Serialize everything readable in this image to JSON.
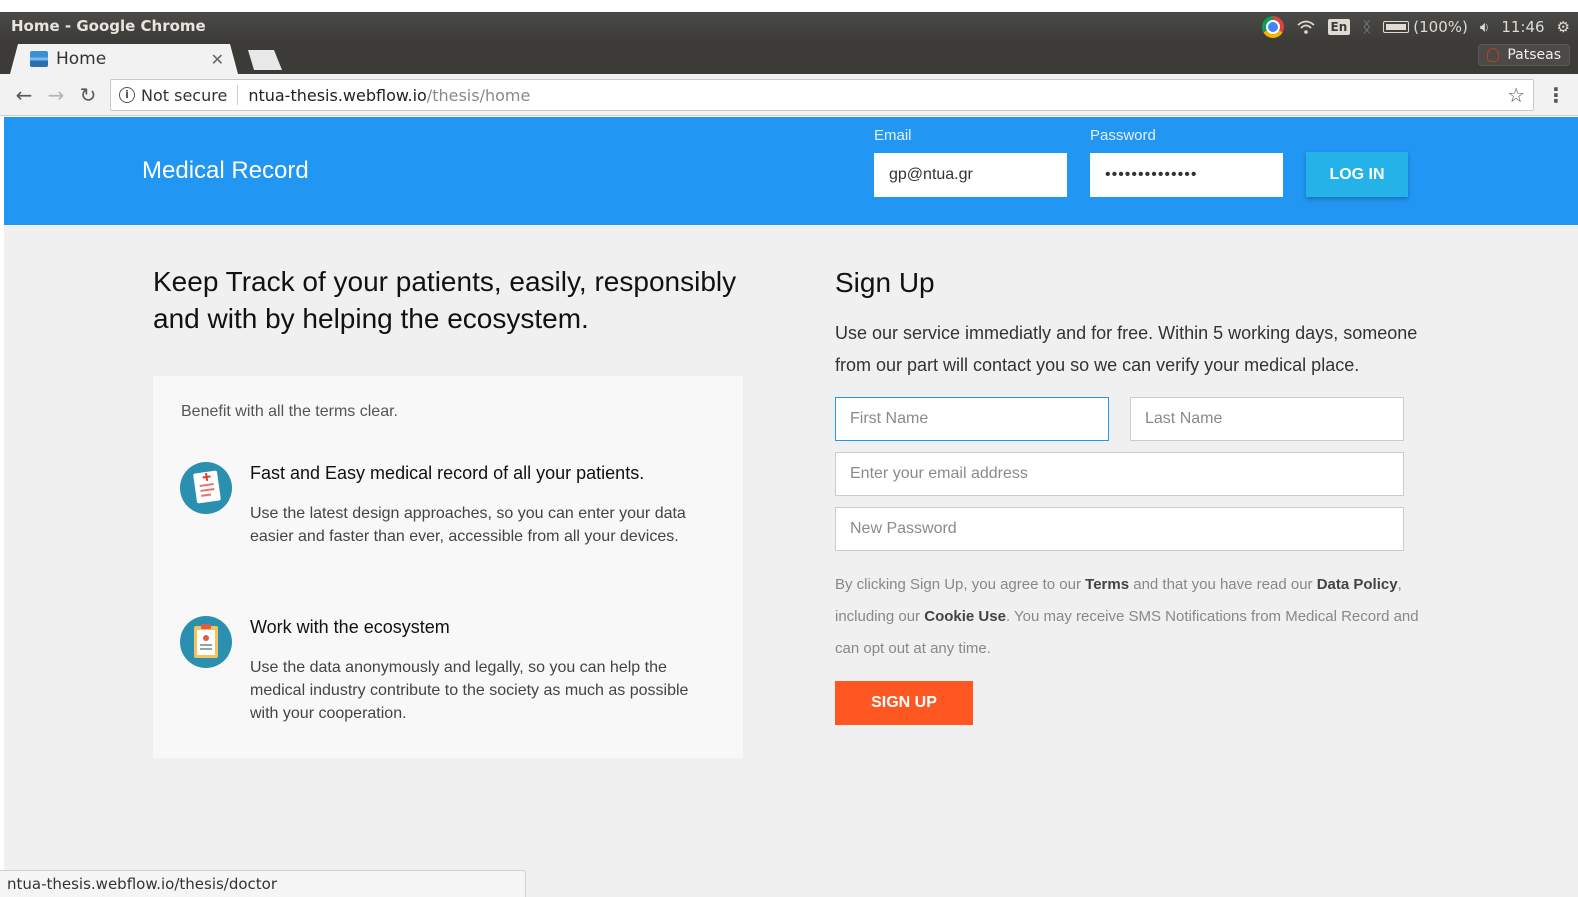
{
  "os": {
    "window_title": "Home - Google Chrome",
    "lang": "En",
    "battery": "(100%)",
    "clock": "11:46",
    "user": "Patseas"
  },
  "browser": {
    "tab_title": "Home",
    "not_secure": "Not secure",
    "url_host": "ntua-thesis.webflow.io",
    "url_path": "/thesis/home",
    "status_url": "ntua-thesis.webflow.io/thesis/doctor"
  },
  "header": {
    "brand": "Medical Record",
    "email_label": "Email",
    "email_value": "gp@ntua.gr",
    "password_label": "Password",
    "password_value": "••••••••••••••",
    "login_label": "LOG IN"
  },
  "hero": {
    "headline": "Keep Track of your patients, easily, responsibly and with by helping the ecosystem."
  },
  "benefits": {
    "intro": "Benefit with all the terms clear.",
    "features": [
      {
        "title": "Fast and Easy medical record of all your patients.",
        "text": "Use the latest design approaches, so you can enter your data easier and faster than ever, accessible from all your devices.",
        "icon": "medical-record-icon"
      },
      {
        "title": "Work with the ecosystem",
        "text": "Use the data anonymously and legally, so you can help the medical industry contribute to the society as much as possible with your cooperation.",
        "icon": "clipboard-icon"
      }
    ]
  },
  "signup": {
    "title": "Sign Up",
    "description": "Use our service immediatly and for free. Within 5 working days, someone from our part will contact you so we can verify your medical place.",
    "first_name_placeholder": "First Name",
    "last_name_placeholder": "Last Name",
    "email_placeholder": "Enter your email address",
    "password_placeholder": "New Password",
    "terms_1": "By clicking Sign Up, you agree to our ",
    "terms_link": "Terms",
    "terms_2": " and that you have read our ",
    "data_policy_link": "Data Policy",
    "terms_3": ", including our ",
    "cookie_link": "Cookie Use",
    "terms_4": ". You may receive SMS Notifications from Medical Record and can opt out at any time.",
    "button_label": "SIGN UP"
  },
  "colors": {
    "header_blue": "#2196f3",
    "login_button": "#25b2e8",
    "signup_button": "#ff5722"
  }
}
